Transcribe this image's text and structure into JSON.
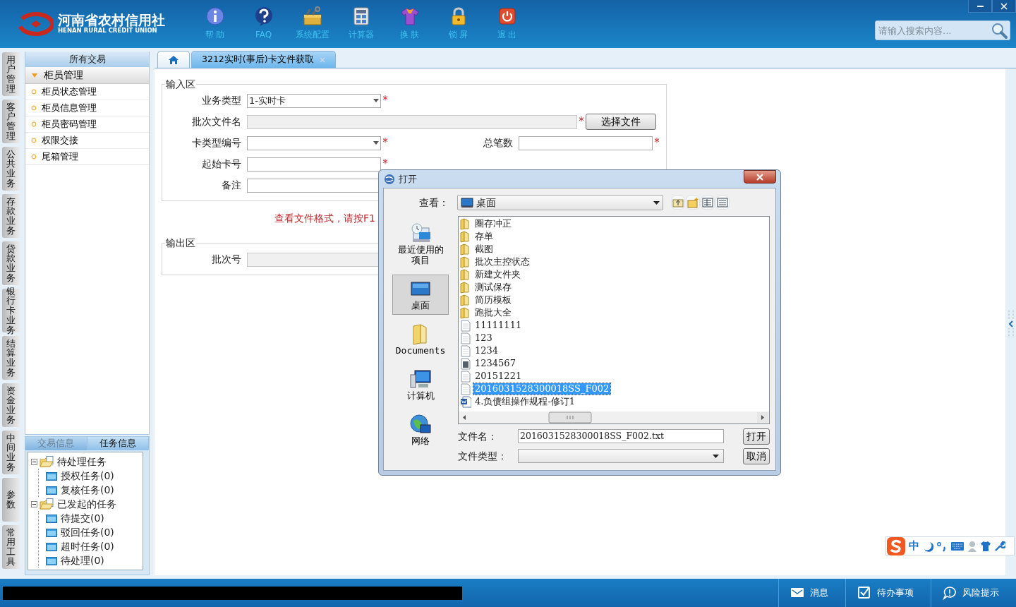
{
  "header": {
    "logo_name": "河南省农村信用社",
    "logo_english": "HENAN RURAL CREDIT UNION",
    "toolbar": [
      {
        "label": "帮 助",
        "kind": "help"
      },
      {
        "label": "FAQ",
        "kind": "faq"
      },
      {
        "label": "系统配置",
        "kind": "config"
      },
      {
        "label": "计算器",
        "kind": "calculator"
      },
      {
        "label": "换 肤",
        "kind": "skin"
      },
      {
        "label": "锁 屏",
        "kind": "lock"
      },
      {
        "label": "退 出",
        "kind": "exit"
      }
    ],
    "search": {
      "placeholder": "请输入搜索内容..."
    }
  },
  "module_tabs": [
    {
      "label": "用户管理"
    },
    {
      "label": "客户管理"
    },
    {
      "label": "公共业务"
    },
    {
      "label": "存款业务"
    },
    {
      "label": "贷款业务"
    },
    {
      "label": "银行卡业务"
    },
    {
      "label": "结算业务"
    },
    {
      "label": "资金业务"
    },
    {
      "label": "中间业务"
    },
    {
      "label": "参数"
    },
    {
      "label": "常用工具"
    }
  ],
  "sidebar": {
    "title": "所有交易",
    "group": {
      "label": "柜员管理",
      "expanded": true
    },
    "items": [
      "柜员状态管理",
      "柜员信息管理",
      "柜员密码管理",
      "权限交接",
      "尾箱管理"
    ]
  },
  "task_panel": {
    "tabs": [
      {
        "label": "交易信息",
        "selected": false
      },
      {
        "label": "任务信息",
        "selected": true
      }
    ],
    "tree": [
      {
        "label": "待处理任务",
        "expanded": true,
        "children": [
          {
            "label": "授权任务(0)"
          },
          {
            "label": "复核任务(0)"
          }
        ]
      },
      {
        "label": "已发起的任务",
        "expanded": true,
        "children": [
          {
            "label": "待提交(0)"
          },
          {
            "label": "驳回任务(0)"
          },
          {
            "label": "超时任务(0)"
          },
          {
            "label": "待处理(0)"
          }
        ]
      }
    ]
  },
  "tabs": [
    {
      "kind": "home",
      "selected": false
    },
    {
      "kind": "page",
      "label": "3212实时(事后)卡文件获取",
      "selected": true
    }
  ],
  "form": {
    "input_section": {
      "title": "输入区",
      "rows": [
        [
          {
            "label": "业务类型",
            "kind": "select",
            "value": "1-实时卡",
            "required_mark": "*"
          }
        ],
        [
          {
            "label": "批次文件名",
            "kind": "readonly",
            "required_mark": "*",
            "button": "选择文件"
          }
        ],
        [
          {
            "label": "卡类型编号",
            "kind": "select",
            "required_mark": "*"
          },
          {
            "label": "总笔数",
            "kind": "text",
            "required_mark": "*"
          }
        ],
        [
          {
            "label": "起始卡号",
            "kind": "text",
            "required_mark": "*"
          }
        ],
        [
          {
            "label": "备注",
            "kind": "text"
          }
        ]
      ]
    },
    "notice": "查看文件格式，请按F1",
    "output_section": {
      "title": "输出区",
      "rows": [
        [
          {
            "label": "批次号",
            "kind": "readonly"
          }
        ]
      ]
    }
  },
  "dialog": {
    "title": "打开",
    "look_in_label": "查看：",
    "look_in_value": "桌面",
    "places": [
      {
        "label": "最近使用的项目",
        "kind": "recent",
        "selected": false
      },
      {
        "label": "桌面",
        "kind": "desktop",
        "selected": true
      },
      {
        "label": "Documents",
        "kind": "documents",
        "selected": false
      },
      {
        "label": "计算机",
        "kind": "computer",
        "selected": false
      },
      {
        "label": "网络",
        "kind": "network",
        "selected": false
      }
    ],
    "files": [
      {
        "name": "圈存冲正",
        "kind": "folder",
        "selected": false
      },
      {
        "name": "存单",
        "kind": "folder",
        "selected": false
      },
      {
        "name": "截图",
        "kind": "folder",
        "selected": false
      },
      {
        "name": "批次主控状态",
        "kind": "folder",
        "selected": false
      },
      {
        "name": "新建文件夹",
        "kind": "folder",
        "selected": false
      },
      {
        "name": "测试保存",
        "kind": "folder",
        "selected": false
      },
      {
        "name": "简历模板",
        "kind": "folder",
        "selected": false
      },
      {
        "name": "跑批大全",
        "kind": "folder",
        "selected": false
      },
      {
        "name": "11111111",
        "kind": "text",
        "selected": false
      },
      {
        "name": "123",
        "kind": "text",
        "selected": false
      },
      {
        "name": "1234",
        "kind": "text",
        "selected": false
      },
      {
        "name": "1234567",
        "kind": "image",
        "selected": false
      },
      {
        "name": "20151221",
        "kind": "text",
        "selected": false
      },
      {
        "name": "2016031528300018SS_F002",
        "kind": "text",
        "selected": true
      },
      {
        "name": "4.负债组操作规程-修订1",
        "kind": "doc",
        "selected": false
      }
    ],
    "filename_label": "文件名：",
    "filename_value": "2016031528300018SS_F002.txt",
    "filetype_label": "文件类型：",
    "buttons": [
      "打开",
      "取消"
    ]
  },
  "ime": {
    "mode": "中"
  },
  "status_bar": [
    {
      "label": "消息",
      "kind": "message"
    },
    {
      "label": "待办事项",
      "kind": "todo"
    },
    {
      "label": "风险提示",
      "kind": "risk"
    }
  ]
}
